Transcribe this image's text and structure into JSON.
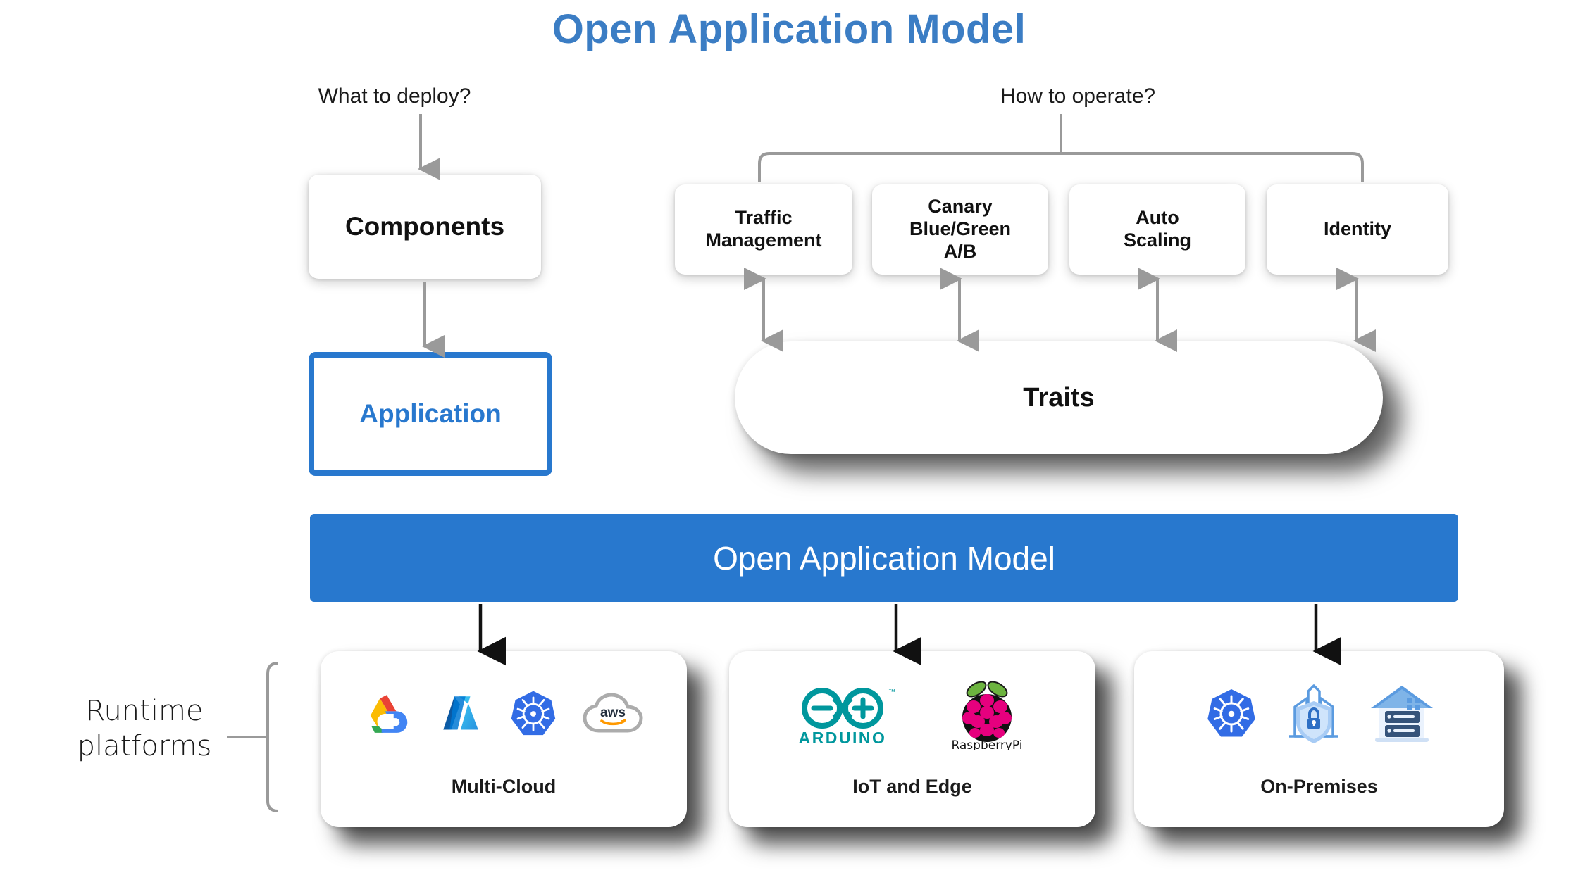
{
  "title": "Open Application Model",
  "title_color": "#3B7DC4",
  "accent_color": "#2878CE",
  "questions": {
    "left": "What to deploy?",
    "right": "How to operate?"
  },
  "left_column": {
    "components_label": "Components",
    "application_label": "Application"
  },
  "traits": {
    "pill_label": "Traits",
    "boxes": [
      {
        "label": "Traffic\nManagement",
        "lines": [
          "Traffic",
          "Management"
        ]
      },
      {
        "label": "Canary\nBlue/Green\nA/B",
        "lines": [
          "Canary",
          "Blue/Green",
          "A/B"
        ]
      },
      {
        "label": "Auto\nScaling",
        "lines": [
          "Auto",
          "Scaling"
        ]
      },
      {
        "label": "Identity",
        "lines": [
          "Identity"
        ]
      }
    ]
  },
  "banner": {
    "label": "Open Application Model",
    "background": "#2878CE",
    "text_color": "#FFFFFF"
  },
  "runtime": {
    "label_line1": "Runtime",
    "label_line2": "platforms",
    "cards": [
      {
        "caption": "Multi-Cloud",
        "logos": [
          {
            "name": "google-cloud-logo",
            "text": ""
          },
          {
            "name": "microsoft-azure-logo",
            "text": ""
          },
          {
            "name": "kubernetes-logo",
            "text": ""
          },
          {
            "name": "aws-logo",
            "text": "aws"
          }
        ]
      },
      {
        "caption": "IoT and Edge",
        "logos": [
          {
            "name": "arduino-logo",
            "text": "ARDUINO"
          },
          {
            "name": "raspberry-pi-logo",
            "text": "RaspberryPi"
          }
        ]
      },
      {
        "caption": "On-Premises",
        "logos": [
          {
            "name": "kubernetes-logo",
            "text": ""
          },
          {
            "name": "secure-datacenter-shield-icon",
            "text": ""
          },
          {
            "name": "datacenter-building-icon",
            "text": ""
          }
        ]
      }
    ]
  }
}
